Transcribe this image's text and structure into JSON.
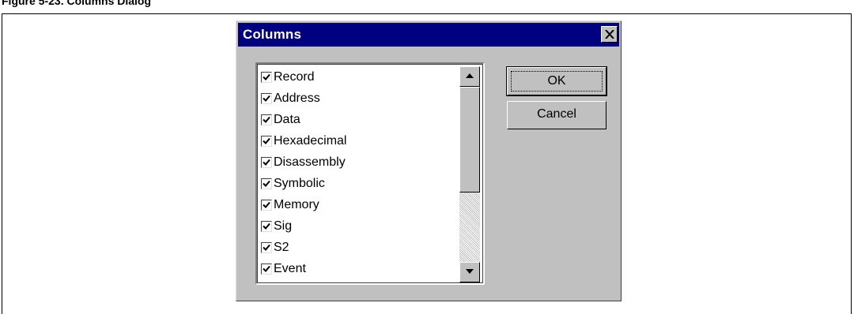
{
  "page": {
    "caption": "Figure 5-23. Columns Dialog"
  },
  "dialog": {
    "title": "Columns",
    "close_icon": "close-x-icon",
    "items": [
      {
        "label": "Record",
        "checked": true
      },
      {
        "label": "Address",
        "checked": true
      },
      {
        "label": "Data",
        "checked": true
      },
      {
        "label": "Hexadecimal",
        "checked": true
      },
      {
        "label": "Disassembly",
        "checked": true
      },
      {
        "label": "Symbolic",
        "checked": true
      },
      {
        "label": "Memory",
        "checked": true
      },
      {
        "label": "Sig",
        "checked": true
      },
      {
        "label": "S2",
        "checked": true
      },
      {
        "label": "Event",
        "checked": true
      }
    ],
    "ok_label": "OK",
    "cancel_label": "Cancel"
  },
  "colors": {
    "title_bar": "#000080",
    "face": "#c0c0c0"
  }
}
